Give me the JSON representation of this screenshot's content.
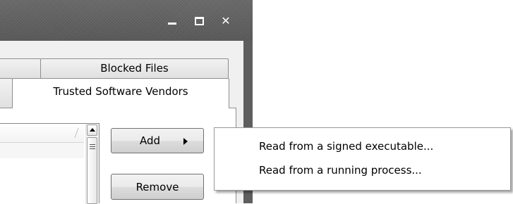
{
  "window": {
    "controls": {
      "minimize_icon": "minimize-icon",
      "maximize_icon": "maximize-icon",
      "close_icon": "close-icon",
      "close_glyph": "✕"
    }
  },
  "tabs": {
    "row1": [
      {
        "label": ""
      },
      {
        "label": "Blocked Files"
      }
    ],
    "row2": [
      {
        "label": ""
      },
      {
        "label": "Trusted Software Vendors",
        "selected": true
      }
    ]
  },
  "list": {
    "header": "",
    "scrollbar": {
      "up_icon": "scroll-up-arrow-icon"
    }
  },
  "buttons": {
    "add_label": "Add",
    "add_arrow_icon": "chevron-right-icon",
    "remove_label": "Remove"
  },
  "context_menu": {
    "items": [
      {
        "label": "Read from a signed executable..."
      },
      {
        "label": "Read from a running process..."
      }
    ]
  },
  "colors": {
    "titlebar": "#5e5e5e",
    "window_bg": "#f0f0f0",
    "menu_border": "#979797"
  }
}
